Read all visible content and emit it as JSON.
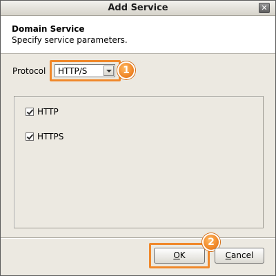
{
  "window": {
    "title": "Add Service",
    "close_glyph": "✕",
    "close_icon": "close-icon"
  },
  "header": {
    "title": "Domain Service",
    "subtitle": "Specify service parameters."
  },
  "protocol": {
    "label": "Protocol",
    "selected": "HTTP/S",
    "dropdown_icon": "chevron-down-icon"
  },
  "options": [
    {
      "label": "HTTP",
      "checked": true
    },
    {
      "label": "HTTPS",
      "checked": true
    }
  ],
  "buttons": {
    "ok_mnemonic": "O",
    "ok_rest": "K",
    "cancel_mnemonic": "C",
    "cancel_rest": "ancel"
  },
  "annotations": {
    "step1": "1",
    "step2": "2",
    "highlight_color": "#f0882a"
  }
}
